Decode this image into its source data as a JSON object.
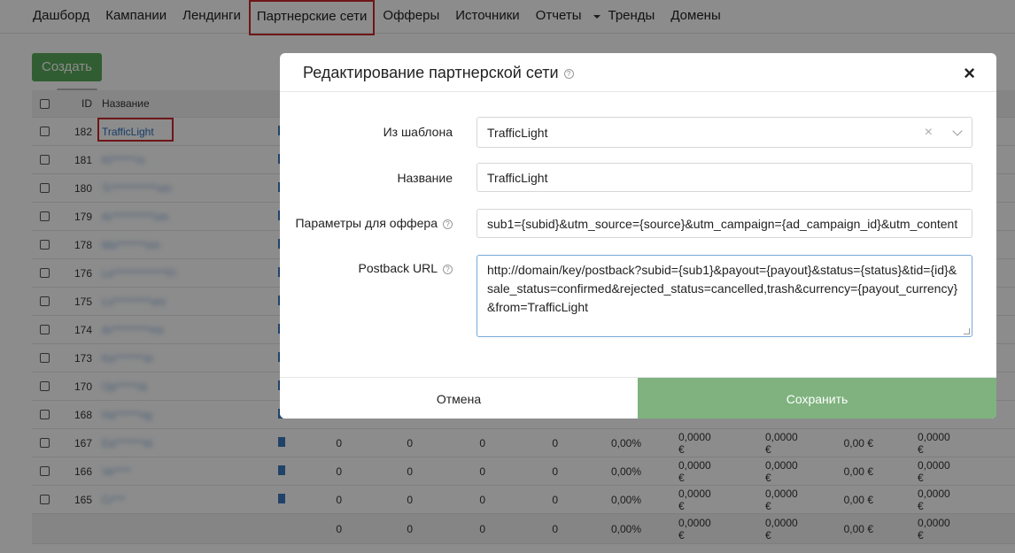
{
  "nav": {
    "items": [
      {
        "label": "Дашборд"
      },
      {
        "label": "Кампании"
      },
      {
        "label": "Лендинги"
      },
      {
        "label": "Партнерские сети",
        "active": true
      },
      {
        "label": "Офферы"
      },
      {
        "label": "Источники"
      },
      {
        "label": "Отчеты",
        "dropdown": true
      },
      {
        "label": "Тренды"
      },
      {
        "label": "Домены"
      }
    ]
  },
  "toolbar": {
    "create_label": "Создать"
  },
  "table": {
    "columns": {
      "id": "ID",
      "name": "Название"
    },
    "rows": [
      {
        "id": "182",
        "name": "TrafficLight",
        "highlighted": true
      },
      {
        "id": "181",
        "name": "Kl******rs"
      },
      {
        "id": "180",
        "name": "Tr***********om"
      },
      {
        "id": "179",
        "name": "Ar**********om"
      },
      {
        "id": "178",
        "name": "Ma*******om"
      },
      {
        "id": "176",
        "name": "Le*************Fi"
      },
      {
        "id": "175",
        "name": "Lo*********om"
      },
      {
        "id": "174",
        "name": "Ar*********ms"
      },
      {
        "id": "173",
        "name": "Ka*******et"
      },
      {
        "id": "170",
        "name": "Op*****ck"
      },
      {
        "id": "168",
        "name": "Ha******ng"
      },
      {
        "id": "167",
        "name": "Ea*******et",
        "stats": [
          "0",
          "0",
          "0",
          "0",
          "0,00%",
          "0,0000 €",
          "0,0000 €",
          "0,00 €",
          "0,0000 €"
        ]
      },
      {
        "id": "166",
        "name": "Ve****",
        "stats": [
          "0",
          "0",
          "0",
          "0",
          "0,00%",
          "0,0000 €",
          "0,0000 €",
          "0,00 €",
          "0,0000 €"
        ]
      },
      {
        "id": "165",
        "name": "Cr***",
        "stats": [
          "0",
          "0",
          "0",
          "0",
          "0,00%",
          "0,0000 €",
          "0,0000 €",
          "0,00 €",
          "0,0000 €"
        ]
      }
    ],
    "totals": [
      "0",
      "0",
      "0",
      "0",
      "0,00%",
      "0,0000 €",
      "0,0000 €",
      "0,00 €",
      "0,0000 €"
    ]
  },
  "modal": {
    "title": "Редактирование партнерской сети",
    "close_label": "×",
    "template_label": "Из шаблона",
    "template_value": "TrafficLight",
    "name_label": "Название",
    "name_value": "TrafficLight",
    "params_label": "Параметры для оффера",
    "params_value": "sub1={subid}&utm_source={source}&utm_campaign={ad_campaign_id}&utm_content",
    "postback_label": "Postback URL",
    "postback_value": "http://domain/key/postback?subid={sub1}&payout={payout}&status={status}&tid={id}&sale_status=confirmed&rejected_status=cancelled,trash&currency={payout_currency}&from=TrafficLight",
    "cancel_label": "Отмена",
    "save_label": "Сохранить"
  }
}
